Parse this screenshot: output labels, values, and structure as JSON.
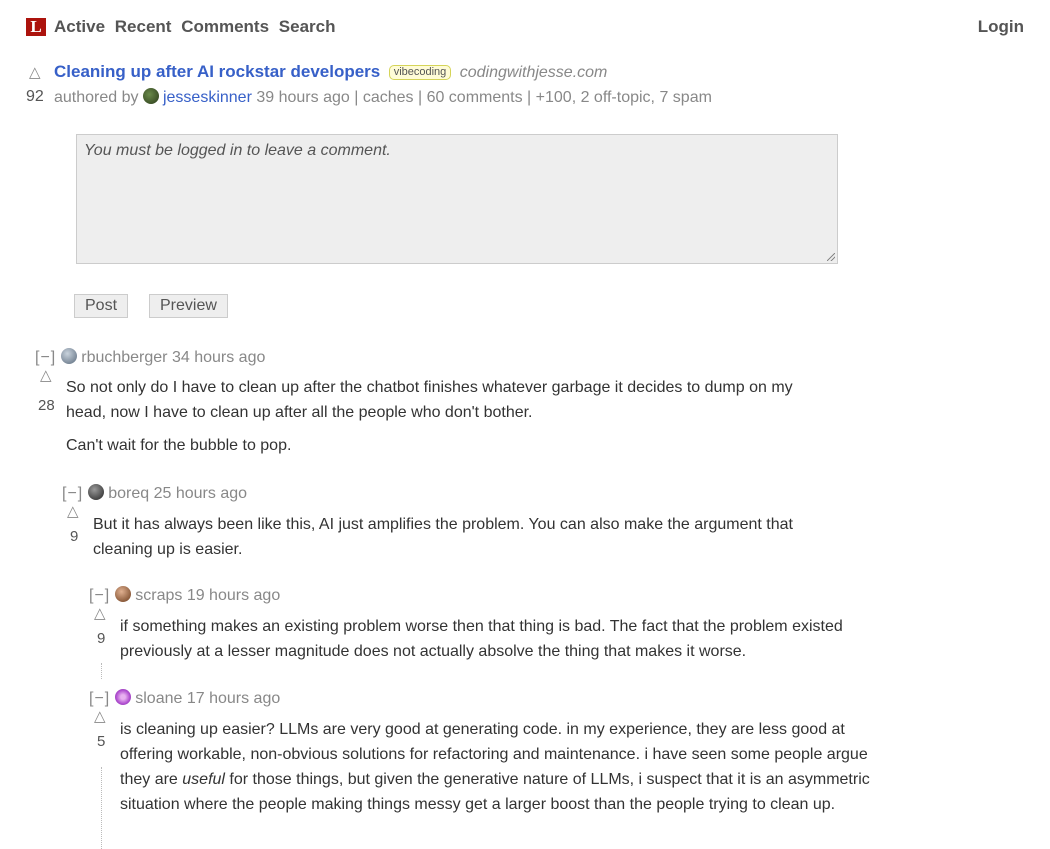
{
  "nav": {
    "logo": "L",
    "links": [
      "Active",
      "Recent",
      "Comments",
      "Search"
    ],
    "login": "Login"
  },
  "story": {
    "title": "Cleaning up after AI rockstar developers",
    "tag": "vibecoding",
    "domain": "codingwithjesse.com",
    "score": "92",
    "authored_by": "authored by",
    "author": "jesseskinner",
    "time": "39 hours ago",
    "caches": "caches",
    "comments": "60 comments",
    "flags": "+100, 2 off-topic, 7 spam"
  },
  "comment_form": {
    "placeholder": "You must be logged in to leave a comment.",
    "post": "Post",
    "preview": "Preview"
  },
  "comments": [
    {
      "toggle": "[−]",
      "user": "rbuchberger",
      "time": "34 hours ago",
      "score": "28",
      "paragraphs": [
        "So not only do I have to clean up after the chatbot finishes whatever garbage it decides to dump on my head, now I have to clean up after all the people who don't bother.",
        "Can't wait for the bubble to pop."
      ],
      "avatar_color": "#7a8a9c"
    },
    {
      "toggle": "[−]",
      "user": "boreq",
      "time": "25 hours ago",
      "score": "9",
      "paragraphs": [
        "But it has always been like this, AI just amplifies the problem. You can also make the argument that cleaning up is easier."
      ],
      "avatar_color": "#3a3a3a"
    },
    {
      "toggle": "[−]",
      "user": "scraps",
      "time": "19 hours ago",
      "score": "9",
      "paragraphs": [
        "if something makes an existing problem worse then that thing is bad. The fact that the problem existed previously at a lesser magnitude does not actually absolve the thing that makes it worse."
      ],
      "avatar_color": "#8a5a3a"
    },
    {
      "toggle": "[−]",
      "user": "sloane",
      "time": "17 hours ago",
      "score": "5",
      "body_a": "is cleaning up easier? LLMs are very good at generating code. in my experience, they are less good at offering workable, non-obvious solutions for refactoring and maintenance. i have seen some people argue they are ",
      "body_em": "useful",
      "body_b": " for those things, but given the generative nature of LLMs, i suspect that it is an asymmetric situation where the people making things messy get a larger boost than the people trying to clean up.",
      "avatar_color": "#b04fd0"
    }
  ],
  "icons": {
    "upvote": "upvote-triangle-icon",
    "resize": "resize-grip-icon"
  },
  "colors": {
    "brand": "#ac130d",
    "link": "#3760c8",
    "tag_bg": "#fffcd7",
    "muted": "#888888"
  }
}
